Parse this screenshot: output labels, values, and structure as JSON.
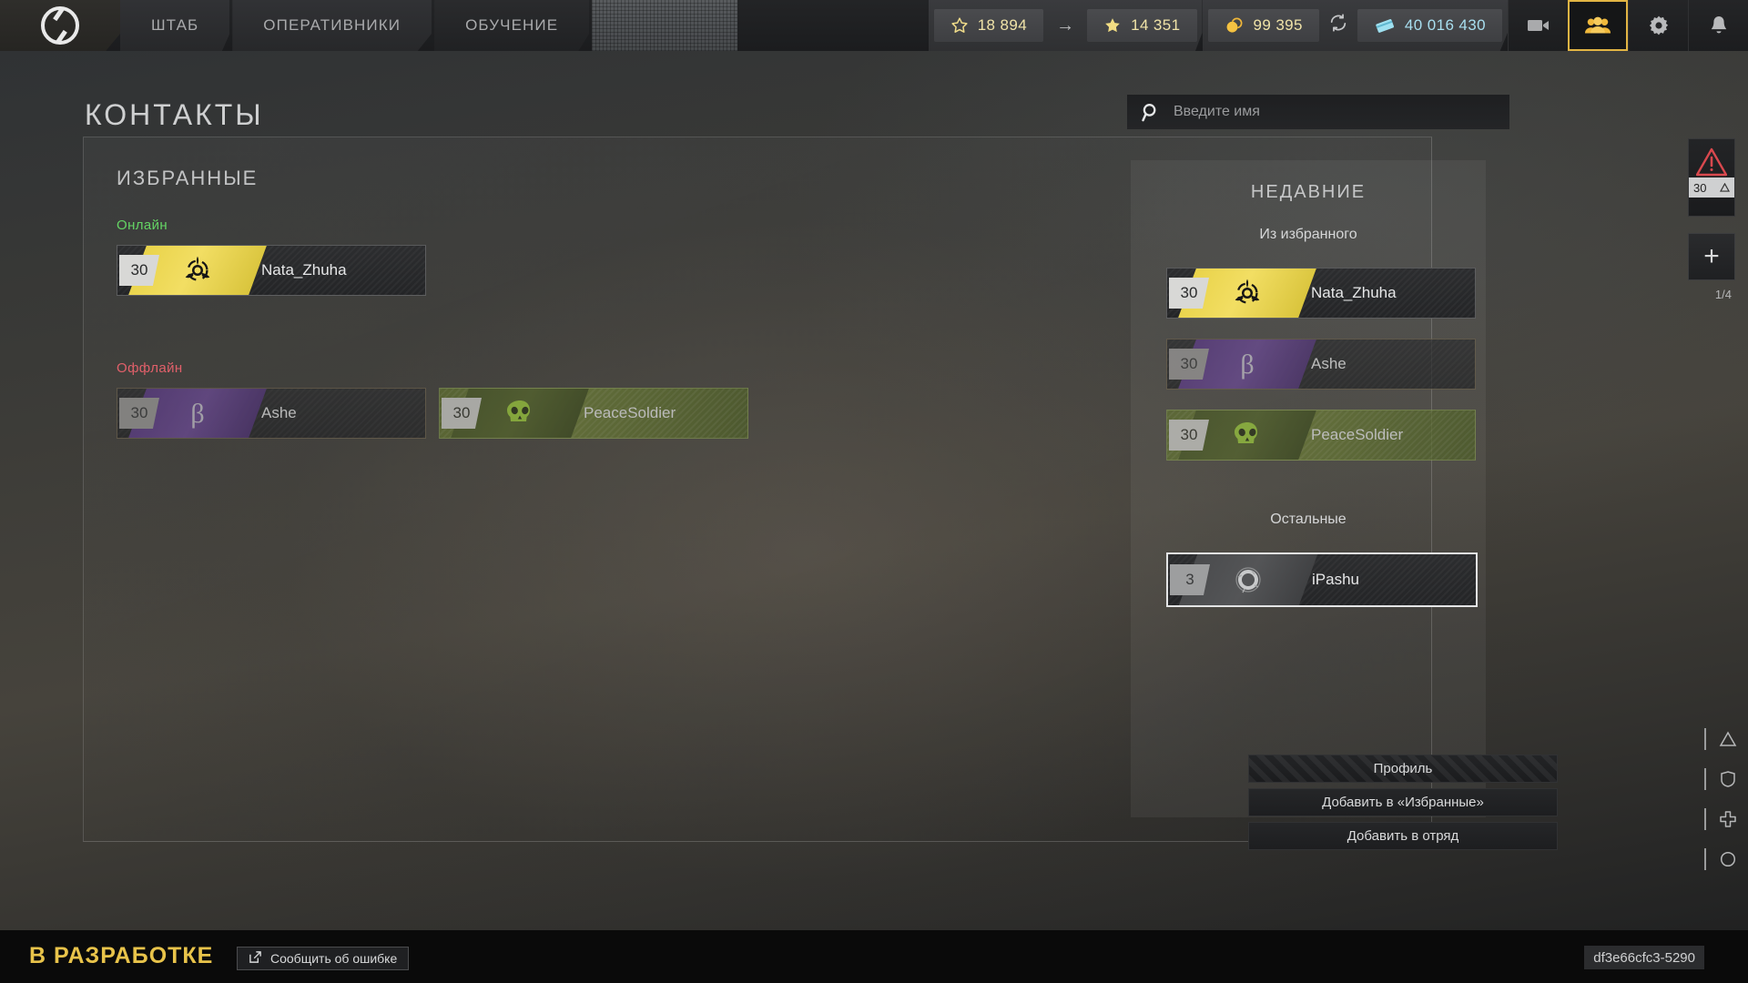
{
  "topbar": {
    "logo_icon": "shutter-logo-icon",
    "tabs": [
      {
        "label": "ШТАБ",
        "icon": "tab-hq-icon"
      },
      {
        "label": "ОПЕРАТИВНИКИ",
        "icon": "tab-operatives-icon"
      },
      {
        "label": "ОБУЧЕНИЕ",
        "icon": "tab-training-icon"
      }
    ],
    "stats": {
      "rating_outline": {
        "icon": "star-outline-icon",
        "value": "18 894"
      },
      "arrow": "→",
      "rating_filled": {
        "icon": "star-filled-icon",
        "value": "14 351"
      },
      "coins": {
        "icon": "coins-icon",
        "value": "99 395"
      },
      "refresh": "refresh-icon",
      "credits": {
        "icon": "credit-card-icon",
        "value": "40 016 430"
      }
    },
    "icon_buttons": [
      {
        "name": "video-icon",
        "active": false
      },
      {
        "name": "friends-icon",
        "active": true
      },
      {
        "name": "gear-icon",
        "active": false
      },
      {
        "name": "bell-icon",
        "active": false
      }
    ],
    "colors": {
      "gold": "#f0e3a8",
      "blue": "#a8dff0",
      "accent": "#e2b544"
    }
  },
  "page": {
    "title": "КОНТАКТЫ",
    "search": {
      "icon": "search-icon",
      "placeholder": "Введите имя",
      "value": ""
    }
  },
  "favorites": {
    "title": "ИЗБРАННЫЕ",
    "online_label": "Онлайн",
    "offline_label": "Оффлайн",
    "online_color": "#64d464",
    "offline_color": "#e1606a",
    "online": [
      {
        "level": "30",
        "name": "Nata_Zhuha",
        "theme": "th-yellow",
        "emblem": "biohazard-icon"
      }
    ],
    "offline": [
      {
        "level": "30",
        "name": "Ashe",
        "theme": "th-purple",
        "emblem": "beta-icon"
      },
      {
        "level": "30",
        "name": "PeaceSoldier",
        "theme": "th-green",
        "emblem": "skull-icon"
      }
    ]
  },
  "recent": {
    "title": "НЕДАВНИЕ",
    "from_favorites_label": "Из избранного",
    "others_label": "Остальные",
    "from_favorites": [
      {
        "level": "30",
        "name": "Nata_Zhuha",
        "theme": "th-yellow",
        "emblem": "biohazard-icon"
      },
      {
        "level": "30",
        "name": "Ashe",
        "theme": "th-purple",
        "emblem": "beta-icon"
      },
      {
        "level": "30",
        "name": "PeaceSoldier",
        "theme": "th-green",
        "emblem": "skull-icon"
      }
    ],
    "others": [
      {
        "level": "3",
        "name": "iPashu",
        "theme": "th-grey",
        "emblem": "shutter-logo-icon"
      }
    ]
  },
  "context_menu": {
    "items": [
      {
        "label": "Профиль",
        "state": "striped"
      },
      {
        "label": "Добавить в «Избранные»",
        "state": "normal"
      },
      {
        "label": "Добавить в отряд",
        "state": "normal"
      }
    ]
  },
  "right_rail": {
    "alert": {
      "icon": "alert-triangle-icon",
      "level": "30",
      "badge_icon": "triangle-icon"
    },
    "add_button": {
      "icon": "plus-icon",
      "label": "+"
    },
    "squad_count": "1/4",
    "tools": [
      {
        "icon": "triangle-outline-icon"
      },
      {
        "icon": "shield-icon"
      },
      {
        "icon": "medkit-icon"
      },
      {
        "icon": "circle-icon"
      }
    ]
  },
  "footer": {
    "dev_label": "В РАЗРАБОТКЕ",
    "bug_button": {
      "icon": "external-link-icon",
      "label": "Сообщить об ошибке"
    },
    "build_id": "df3e66cfc3-5290"
  }
}
